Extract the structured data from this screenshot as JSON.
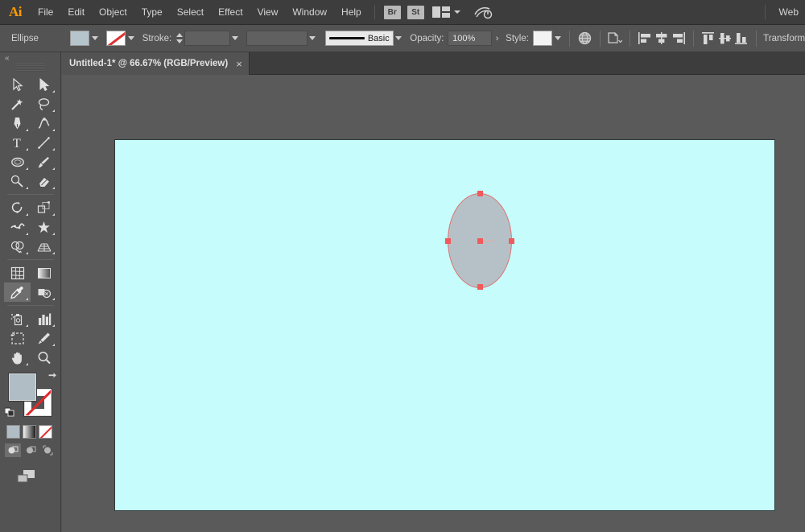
{
  "app": {
    "logo": "Ai",
    "menus": [
      "File",
      "Edit",
      "Object",
      "Type",
      "Select",
      "Effect",
      "View",
      "Window",
      "Help"
    ],
    "bridge_badge": "Br",
    "stock_badge": "St",
    "workspace_label": "Web",
    "accent_color": "#ff9a00",
    "chrome_color": "#3d3d3d",
    "panel_color": "#535353"
  },
  "control_bar": {
    "selection_label": "Ellipse",
    "fill_color": "#b6c4cc",
    "stroke_color": "none",
    "stroke_label": "Stroke:",
    "stroke_weight": "",
    "brush_name": "Basic",
    "opacity_label": "Opacity:",
    "opacity_value": "100%",
    "style_label": "Style:",
    "style_color": "#f3f3f3",
    "transform_label": "Transform",
    "icons": {
      "web_safe": "globe-icon",
      "shape_options": "shape-options-icon",
      "align_left": "align-left-icon",
      "align_center_h": "align-center-horizontal-icon",
      "align_right": "align-right-icon",
      "align_top": "align-top-icon",
      "align_center_v": "align-center-vertical-icon",
      "align_bottom": "align-bottom-icon"
    }
  },
  "document_tab": {
    "title": "Untitled-1* @ 66.67% (RGB/Preview)",
    "close": "×"
  },
  "toolbar": {
    "collapse": "«",
    "tools": [
      {
        "name": "selection-tool",
        "active": false
      },
      {
        "name": "direct-selection-tool",
        "active": false
      },
      {
        "name": "magic-wand-tool",
        "active": false
      },
      {
        "name": "lasso-tool",
        "active": false
      },
      {
        "name": "pen-tool",
        "active": false
      },
      {
        "name": "curvature-tool",
        "active": false
      },
      {
        "name": "type-tool",
        "active": false
      },
      {
        "name": "line-segment-tool",
        "active": false
      },
      {
        "name": "ellipse-tool",
        "active": false
      },
      {
        "name": "paintbrush-tool",
        "active": false
      },
      {
        "name": "shaper-tool",
        "active": false
      },
      {
        "name": "eraser-tool",
        "active": false
      },
      {
        "name": "rotate-tool",
        "active": false
      },
      {
        "name": "scale-tool",
        "active": false
      },
      {
        "name": "width-tool",
        "active": false
      },
      {
        "name": "free-transform-tool",
        "active": false
      },
      {
        "name": "shape-builder-tool",
        "active": false
      },
      {
        "name": "perspective-grid-tool",
        "active": false
      },
      {
        "name": "mesh-tool",
        "active": false
      },
      {
        "name": "gradient-tool",
        "active": false
      },
      {
        "name": "eyedropper-tool",
        "active": true
      },
      {
        "name": "blend-tool",
        "active": false
      },
      {
        "name": "symbol-sprayer-tool",
        "active": false
      },
      {
        "name": "column-graph-tool",
        "active": false
      },
      {
        "name": "artboard-tool",
        "active": false
      },
      {
        "name": "slice-tool",
        "active": false
      },
      {
        "name": "hand-tool",
        "active": false
      },
      {
        "name": "zoom-tool",
        "active": false
      }
    ],
    "fill_color": "#b1bdc5",
    "stroke_color": "none",
    "mode_buttons": [
      "color-mode",
      "gradient-mode",
      "none-mode"
    ],
    "draw_modes": [
      "draw-normal",
      "draw-behind",
      "draw-inside"
    ],
    "screen_mode": "change-screen-mode-icon"
  },
  "canvas": {
    "background": "#5a5a5a",
    "artboard_color": "#c6fcfc",
    "shape": {
      "type": "ellipse",
      "fill": "#b6c1c7",
      "selection_color": "#f05a5a",
      "anchors": [
        "top",
        "right",
        "bottom",
        "left",
        "center"
      ]
    }
  }
}
